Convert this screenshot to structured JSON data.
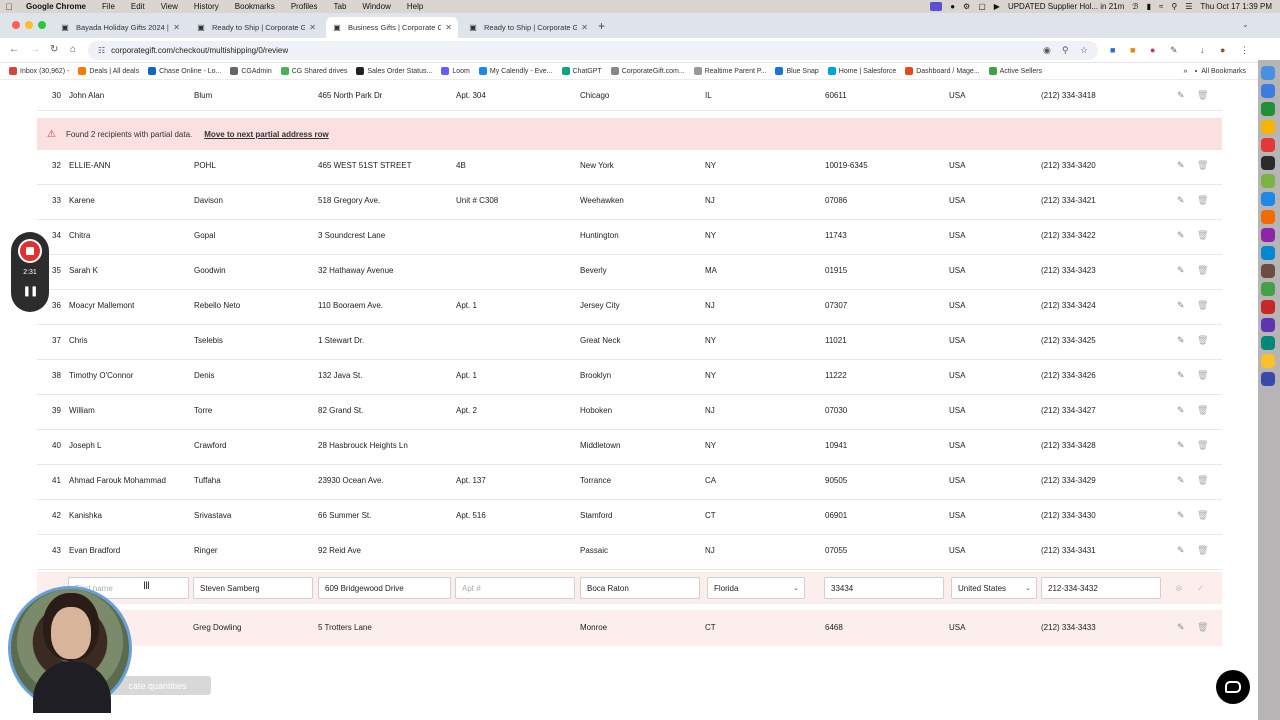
{
  "menubar": {
    "app": "Google Chrome",
    "items": [
      "File",
      "Edit",
      "View",
      "History",
      "Bookmarks",
      "Profiles",
      "Tab",
      "Window",
      "Help"
    ],
    "notification": "UPDATED Supplier Hol... in 21m",
    "datetime": "Thu Oct 17  1:39 PM"
  },
  "tabs": [
    {
      "title": "Bayada Holiday Gifts 2024 | C",
      "active": false
    },
    {
      "title": "Ready to Ship | Corporate Gif",
      "active": false
    },
    {
      "title": "Business Gifts | Corporate Gif",
      "active": true
    },
    {
      "title": "Ready to Ship | Corporate Gif",
      "active": false
    }
  ],
  "url": "corporategift.com/checkout/multishipping/0/review",
  "bookmarks": [
    {
      "label": "Inbox (30,962) -",
      "color": "#d44638"
    },
    {
      "label": "Deals | All deals",
      "color": "#f57c00"
    },
    {
      "label": "Chase Online - Lo...",
      "color": "#1565c0"
    },
    {
      "label": "CGAdmin",
      "color": "#666666"
    },
    {
      "label": "CG Shared drives",
      "color": "#4caf50"
    },
    {
      "label": "Sales Order Status...",
      "color": "#222222"
    },
    {
      "label": "Loom",
      "color": "#625df5"
    },
    {
      "label": "My Calendly - Eve...",
      "color": "#1e88e5"
    },
    {
      "label": "ChatGPT",
      "color": "#10a37f"
    },
    {
      "label": "CorporateGift.com...",
      "color": "#888888"
    },
    {
      "label": "Realtime Parent P...",
      "color": "#999999"
    },
    {
      "label": "Blue Snap",
      "color": "#1976d2"
    },
    {
      "label": "Home | Salesforce",
      "color": "#00a1e0"
    },
    {
      "label": "Dashboard / Mage...",
      "color": "#e64a19"
    },
    {
      "label": "Active Sellers",
      "color": "#43a047"
    }
  ],
  "bookmarks_more": "»",
  "all_bookmarks": "All Bookmarks",
  "warning": {
    "text": "Found 2 recipients with partial data.",
    "link": "Move to next partial address row"
  },
  "top_row": {
    "num": "30",
    "first": "John Alan",
    "last": "Blum",
    "address": "465 North Park Dr",
    "apt": "Apt. 304",
    "city": "Chicago",
    "state": "IL",
    "zip": "60611",
    "country": "USA",
    "phone": "(212) 334-3418"
  },
  "rows": [
    {
      "num": "32",
      "first": "ELLIE-ANN",
      "last": "POHL",
      "address": "465 WEST 51ST STREET",
      "apt": "4B",
      "city": "New York",
      "state": "NY",
      "zip": "10019-6345",
      "country": "USA",
      "phone": "(212) 334-3420"
    },
    {
      "num": "33",
      "first": "Karene",
      "last": "Davison",
      "address": "518 Gregory Ave.",
      "apt": "Unit # C308",
      "city": "Weehawken",
      "state": "NJ",
      "zip": "07086",
      "country": "USA",
      "phone": "(212) 334-3421"
    },
    {
      "num": "34",
      "first": "Chitra",
      "last": "Gopal",
      "address": "3 Soundcrest Lane",
      "apt": "",
      "city": "Huntington",
      "state": "NY",
      "zip": "11743",
      "country": "USA",
      "phone": "(212) 334-3422"
    },
    {
      "num": "35",
      "first": "Sarah K",
      "last": "Goodwin",
      "address": "32 Hathaway Avenue",
      "apt": "",
      "city": "Beverly",
      "state": "MA",
      "zip": "01915",
      "country": "USA",
      "phone": "(212) 334-3423"
    },
    {
      "num": "36",
      "first": "Moacyr Mallemont",
      "last": "Rebello Neto",
      "address": "110 Booraem Ave.",
      "apt": "Apt. 1",
      "city": "Jersey City",
      "state": "NJ",
      "zip": "07307",
      "country": "USA",
      "phone": "(212) 334-3424"
    },
    {
      "num": "37",
      "first": "Chris",
      "last": "Tselebis",
      "address": "1 Stewart Dr.",
      "apt": "",
      "city": "Great Neck",
      "state": "NY",
      "zip": "11021",
      "country": "USA",
      "phone": "(212) 334-3425"
    },
    {
      "num": "38",
      "first": "Timothy O'Connor",
      "last": "Denis",
      "address": "132 Java St.",
      "apt": "Apt. 1",
      "city": "Brooklyn",
      "state": "NY",
      "zip": "11222",
      "country": "USA",
      "phone": "(212) 334-3426"
    },
    {
      "num": "39",
      "first": "William",
      "last": "Torre",
      "address": "82 Grand St.",
      "apt": "Apt. 2",
      "city": "Hoboken",
      "state": "NJ",
      "zip": "07030",
      "country": "USA",
      "phone": "(212) 334-3427"
    },
    {
      "num": "40",
      "first": "Joseph L",
      "last": "Crawford",
      "address": "28 Hasbrouck Heights Ln",
      "apt": "",
      "city": "Middletown",
      "state": "NY",
      "zip": "10941",
      "country": "USA",
      "phone": "(212) 334-3428"
    },
    {
      "num": "41",
      "first": "Ahmad Farouk Mohammad",
      "last": "Tuffaha",
      "address": "23930 Ocean Ave.",
      "apt": "Apt. 137",
      "city": "Torrance",
      "state": "CA",
      "zip": "90505",
      "country": "USA",
      "phone": "(212) 334-3429"
    },
    {
      "num": "42",
      "first": "Kanishka",
      "last": "Srivastava",
      "address": "66 Summer St.",
      "apt": "Apt. 516",
      "city": "Stamford",
      "state": "CT",
      "zip": "06901",
      "country": "USA",
      "phone": "(212) 334-3430"
    },
    {
      "num": "43",
      "first": "Evan Bradford",
      "last": "Ringer",
      "address": "92 Reid Ave",
      "apt": "",
      "city": "Passaic",
      "state": "NJ",
      "zip": "07055",
      "country": "USA",
      "phone": "(212) 334-3431"
    }
  ],
  "edit_row": {
    "first_placeholder": "First name",
    "last": "Steven Samberg",
    "address": "609 Bridgewood Drive",
    "apt_placeholder": "Apt #",
    "city": "Boca Raton",
    "state": "Florida",
    "zip": "33434",
    "country": "United States",
    "phone": "212-334-3432"
  },
  "row44": {
    "last": "Greg Dowling",
    "address": "5 Trotters Lane",
    "city": "Monroe",
    "state": "CT",
    "zip": "6468",
    "country": "USA",
    "phone": "(212) 334-3433"
  },
  "recorder": {
    "time": "2:31"
  },
  "duplicate_button": "cate quantities"
}
